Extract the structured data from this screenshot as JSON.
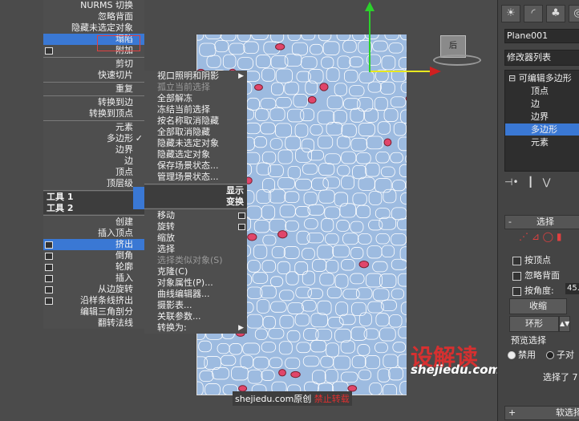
{
  "quad_left": {
    "items": [
      {
        "label": "NURMS 切换"
      },
      {
        "label": "忽略背面"
      },
      {
        "label": "隐藏未选定对象"
      },
      {
        "label": "塌陷"
      },
      {
        "label": "附加"
      },
      {
        "label": "剪切"
      },
      {
        "label": "快速切片"
      },
      {
        "label": "重复"
      },
      {
        "label": "转换到边"
      },
      {
        "label": "转换到顶点"
      },
      {
        "label": "元素"
      },
      {
        "label": "多边形"
      },
      {
        "label": "边界"
      },
      {
        "label": "边"
      },
      {
        "label": "顶点"
      },
      {
        "label": "顶层级"
      },
      {
        "label": "创建"
      },
      {
        "label": "插入顶点"
      },
      {
        "label": "挤出"
      },
      {
        "label": "倒角"
      },
      {
        "label": "轮廓"
      },
      {
        "label": "插入"
      },
      {
        "label": "从边旋转"
      },
      {
        "label": "沿样条线挤出"
      },
      {
        "label": "编辑三角剖分"
      },
      {
        "label": "翻转法线"
      }
    ],
    "header1": "工具 1",
    "header2": "工具 2",
    "checkmark": "✓"
  },
  "quad_right": {
    "items": [
      {
        "label": "视口照明和阴影"
      },
      {
        "label": "孤立当前选择"
      },
      {
        "label": "全部解冻"
      },
      {
        "label": "冻结当前选择"
      },
      {
        "label": "按名称取消隐藏"
      },
      {
        "label": "全部取消隐藏"
      },
      {
        "label": "隐藏未选定对象"
      },
      {
        "label": "隐藏选定对象"
      },
      {
        "label": "保存场景状态..."
      },
      {
        "label": "管理场景状态..."
      },
      {
        "label": "移动"
      },
      {
        "label": "旋转"
      },
      {
        "label": "缩放"
      },
      {
        "label": "选择"
      },
      {
        "label": "选择类似对象(S)"
      },
      {
        "label": "克隆(C)"
      },
      {
        "label": "对象属性(P)..."
      },
      {
        "label": "曲线编辑器..."
      },
      {
        "label": "摄影表..."
      },
      {
        "label": "关联参数..."
      },
      {
        "label": "转换为:"
      }
    ],
    "header1": "显示",
    "header2": "变换"
  },
  "viewcube_label": "后",
  "watermark": {
    "logo": "设解读",
    "domain": "shejiedu.com"
  },
  "caption": {
    "part1": "shejiedu.com原创",
    "part2": "禁止转载"
  },
  "panel": {
    "object_name": "Plane001",
    "modifier_list": "修改器列表",
    "stack": [
      "可编辑多边形",
      "顶点",
      "边",
      "边界",
      "多边形",
      "元素"
    ],
    "selection_title": "选择",
    "by_vertex": "按顶点",
    "ignore_backfacing": "忽略背面",
    "by_angle": "按角度:",
    "angle_value": "45.",
    "shrink": "收缩",
    "ring": "环形",
    "preview_selection": "预览选择",
    "disabled": "禁用",
    "subobject": "子对",
    "selected": "选择了 7",
    "soft_selection": "软选择"
  },
  "colors": {
    "selection_blue": "#3a78d4",
    "plane": "#9dbbe0",
    "selected_poly": "#e0456a"
  }
}
